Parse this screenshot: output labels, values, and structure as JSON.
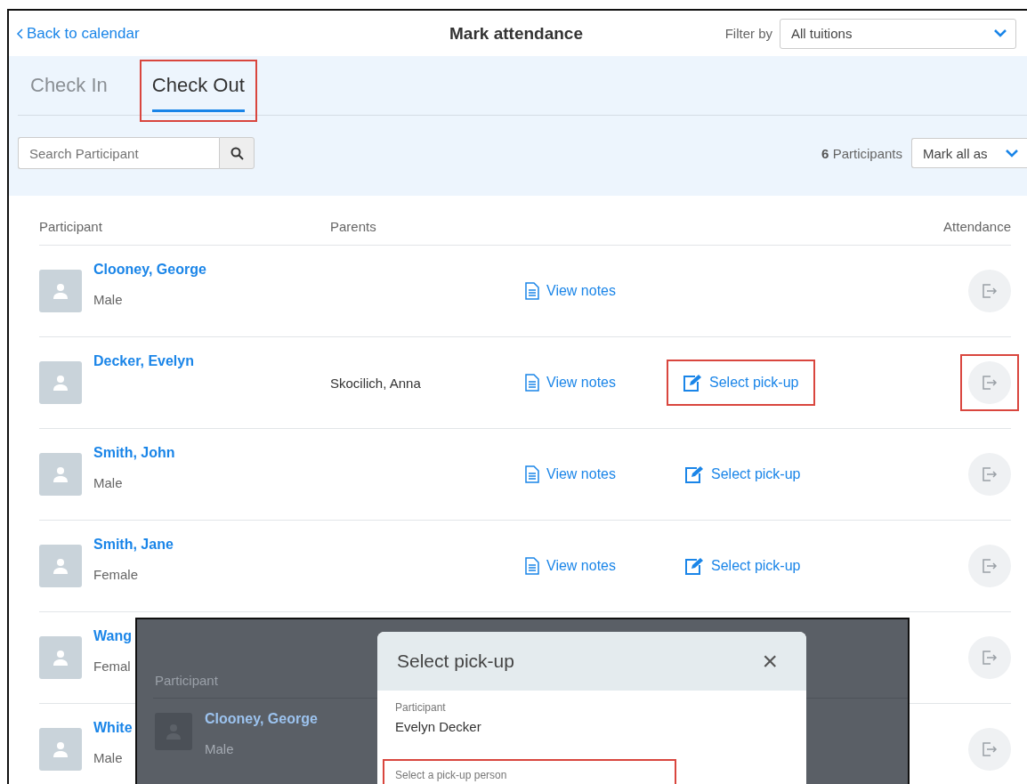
{
  "header": {
    "back_link": "Back to calendar",
    "title": "Mark attendance",
    "filter_label": "Filter by",
    "filter_value": "All tuitions"
  },
  "tabs": [
    {
      "label": "Check In",
      "selected": false,
      "highlighted": false
    },
    {
      "label": "Check Out",
      "selected": true,
      "highlighted": true
    }
  ],
  "search": {
    "placeholder": "Search Participant"
  },
  "participants_count": {
    "number": "6",
    "label": "Participants"
  },
  "mark_all": "Mark all as",
  "table": {
    "columns": [
      "Participant",
      "Parents",
      "Attendance"
    ],
    "rows": [
      {
        "name": "Clooney, George",
        "gender": "Male",
        "parent": "",
        "notes": "View notes",
        "pickup": "",
        "attendance_highlighted": false
      },
      {
        "name": "Decker, Evelyn",
        "gender": "",
        "parent": "Skocilich, Anna",
        "notes": "View notes",
        "pickup": "Select pick-up",
        "pickup_highlighted": true,
        "attendance_highlighted": true
      },
      {
        "name": "Smith, John",
        "gender": "Male",
        "parent": "",
        "notes": "View notes",
        "pickup": "Select pick-up",
        "pickup_highlighted": false,
        "attendance_highlighted": false
      },
      {
        "name": "Smith, Jane",
        "gender": "Female",
        "parent": "",
        "notes": "View notes",
        "pickup": "Select pick-up",
        "pickup_highlighted": false,
        "attendance_highlighted": false
      },
      {
        "name": "Wang",
        "gender": "Femal",
        "parent": "",
        "notes": "",
        "pickup": "",
        "attendance_highlighted": false
      },
      {
        "name": "White",
        "gender": "Male",
        "parent": "",
        "notes": "",
        "pickup": "",
        "attendance_highlighted": false
      }
    ]
  },
  "inset": {
    "background": {
      "column": "Participant",
      "name": "Clooney, George",
      "gender": "Male"
    },
    "modal": {
      "title": "Select pick-up",
      "close": "×",
      "participant_label": "Participant",
      "participant_value": "Evelyn Decker",
      "field_label": "Select a pick-up person",
      "field_highlighted": true
    }
  }
}
